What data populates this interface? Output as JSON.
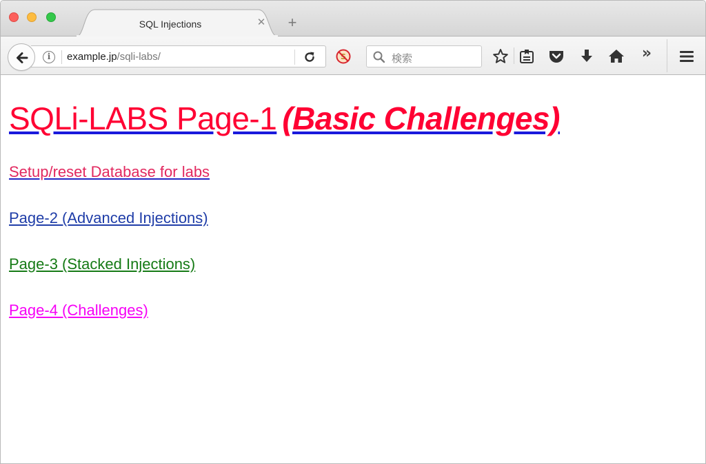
{
  "browser": {
    "tab": {
      "title": "SQL Injections"
    },
    "address": {
      "host": "example.jp",
      "path": "/sqli-labs/"
    },
    "search": {
      "placeholder": "検索"
    }
  },
  "page": {
    "title_main": "SQLi-LABS Page-1",
    "title_em": "(Basic Challenges)",
    "links": [
      {
        "label": "Setup/reset Database for labs"
      },
      {
        "label": "Page-2 (Advanced Injections)"
      },
      {
        "label": "Page-3 (Stacked Injections)"
      },
      {
        "label": "Page-4 (Challenges)"
      }
    ]
  },
  "icons": {
    "back": "back-arrow-icon",
    "info": "info-icon",
    "reload": "reload-icon",
    "noscript": "noscript-icon",
    "search": "search-icon",
    "bookmark": "bookmark-star-icon",
    "reading_list": "reading-list-icon",
    "pocket": "pocket-icon",
    "downloads": "download-icon",
    "home": "home-icon",
    "overflow": "overflow-chevron-icon",
    "menu": "hamburger-menu-icon"
  },
  "colors": {
    "title": "#ff0033",
    "link_setup": "#e2285f",
    "link_page2": "#1f3da8",
    "link_page3": "#157a15",
    "link_page4": "#f600f6"
  }
}
